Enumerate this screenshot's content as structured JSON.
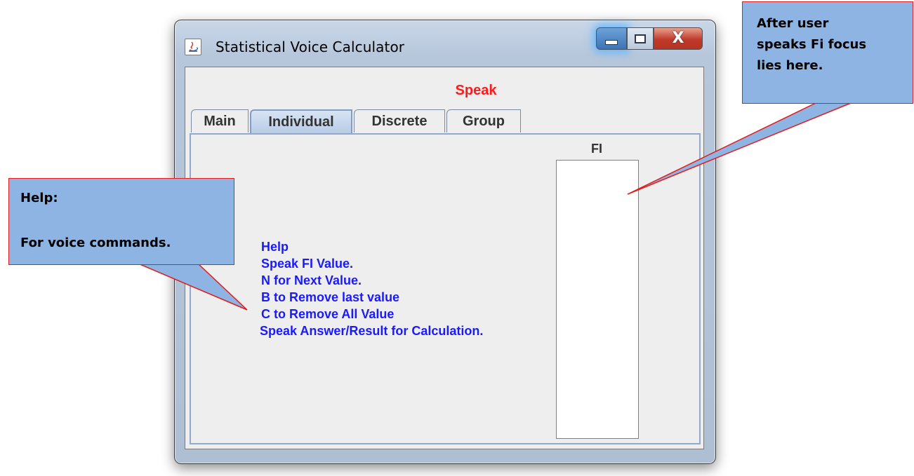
{
  "window": {
    "title": "Statistical Voice Calculator",
    "speak_status": "Speak",
    "tabs": [
      {
        "label": "Main",
        "selected": false
      },
      {
        "label": "Individual",
        "selected": true
      },
      {
        "label": "Discrete",
        "selected": false
      },
      {
        "label": "Group",
        "selected": false
      }
    ],
    "fi_label": "FI",
    "fi_value": "",
    "help_lines": [
      "Help",
      "Speak FI Value.",
      "N for Next Value.",
      "B to Remove last value",
      "C to Remove All Value",
      "Speak Answer/Result for Calculation."
    ]
  },
  "callouts": {
    "right": [
      "After user",
      "speaks Fi focus",
      "lies here."
    ],
    "left": [
      "Help:",
      "For voice commands."
    ]
  },
  "colors": {
    "speak_red": "#ff1a1a",
    "help_blue": "#1a1aff",
    "callout_fill": "#8eb4e3",
    "callout_border": "#e21b1b"
  },
  "icons": [
    "java-app-icon",
    "minimize-icon",
    "maximize-icon",
    "close-icon"
  ]
}
